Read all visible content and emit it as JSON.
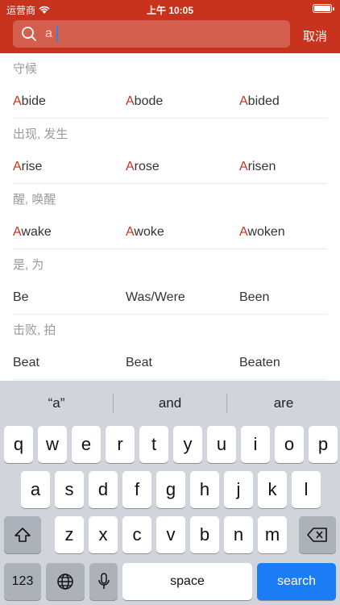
{
  "status": {
    "carrier": "运营商",
    "time": "上午 10:05"
  },
  "search": {
    "query": "a",
    "cancel_label": "取消"
  },
  "entries": [
    {
      "meaning": "守候",
      "forms": [
        [
          "A",
          "bide"
        ],
        [
          "A",
          "bode"
        ],
        [
          "A",
          "bided"
        ]
      ]
    },
    {
      "meaning": "出现, 发生",
      "forms": [
        [
          "A",
          "rise"
        ],
        [
          "A",
          "rose"
        ],
        [
          "A",
          "risen"
        ]
      ]
    },
    {
      "meaning": "醒, 唤醒",
      "forms": [
        [
          "A",
          "wake"
        ],
        [
          "A",
          "woke"
        ],
        [
          "A",
          "woken"
        ]
      ]
    },
    {
      "meaning": "是, 为",
      "forms": [
        [
          "",
          "Be"
        ],
        [
          "",
          "Was/Were"
        ],
        [
          "",
          "Been"
        ]
      ]
    },
    {
      "meaning": "击败, 拍",
      "forms": [
        [
          "",
          "Beat"
        ],
        [
          "",
          "Beat"
        ],
        [
          "",
          "Beaten"
        ]
      ]
    }
  ],
  "keyboard": {
    "suggestions": [
      "“a”",
      "and",
      "are"
    ],
    "row1": [
      "q",
      "w",
      "e",
      "r",
      "t",
      "y",
      "u",
      "i",
      "o",
      "p"
    ],
    "row2": [
      "a",
      "s",
      "d",
      "f",
      "g",
      "h",
      "j",
      "k",
      "l"
    ],
    "row3": [
      "z",
      "x",
      "c",
      "v",
      "b",
      "n",
      "m"
    ],
    "numbers_label": "123",
    "space_label": "space",
    "search_label": "search"
  }
}
